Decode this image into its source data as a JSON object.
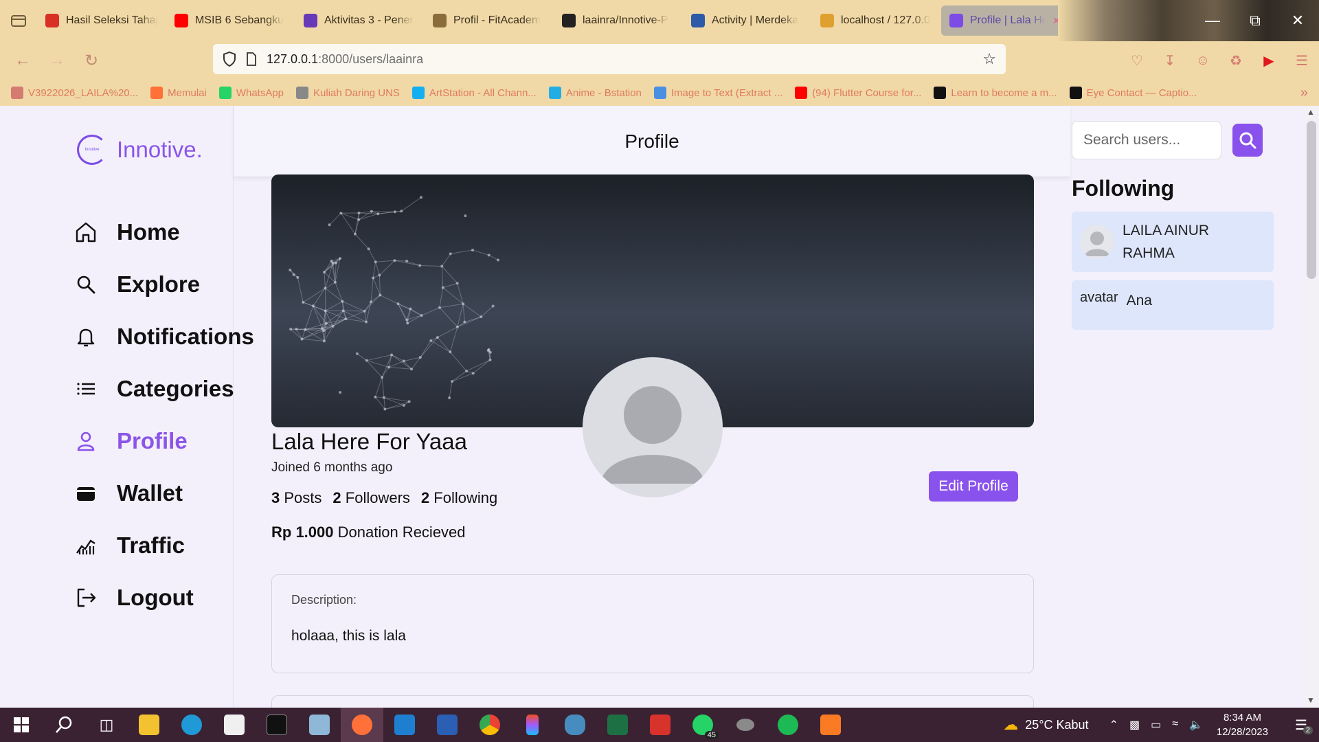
{
  "browser": {
    "tabs": [
      {
        "label": "Hasil Seleksi Tahap",
        "favicon": "gmail-icon",
        "color": "#d93025"
      },
      {
        "label": "MSIB 6 Sebangku",
        "favicon": "youtube-icon",
        "color": "#ff0000"
      },
      {
        "label": "Aktivitas 3 - Pener",
        "favicon": "forms-icon",
        "color": "#673ab7"
      },
      {
        "label": "Profil - FitAcadem",
        "favicon": "cap-icon",
        "color": "#8a6d3b"
      },
      {
        "label": "laainra/Innotive-P",
        "favicon": "github-icon",
        "color": "#222222"
      },
      {
        "label": "Activity | Merdeka",
        "favicon": "kampus-icon",
        "color": "#2d5aa8"
      },
      {
        "label": "localhost / 127.0.0",
        "favicon": "pma-icon",
        "color": "#e0a030"
      },
      {
        "label": "Profile | Lala He",
        "favicon": "loading-icon",
        "color": "#7d4be6",
        "active": true
      }
    ],
    "url": {
      "host": "127.0.0.1",
      "path": ":8000/users/laainra"
    },
    "bookmarks": [
      {
        "label": "V3922026_LAILA%20...",
        "color": "#d47b72"
      },
      {
        "label": "Memulai",
        "color": "#ff7139"
      },
      {
        "label": "WhatsApp",
        "color": "#25d366"
      },
      {
        "label": "Kuliah Daring UNS",
        "color": "#888888"
      },
      {
        "label": "ArtStation - All Chann...",
        "color": "#13aff0"
      },
      {
        "label": "Anime - Bstation",
        "color": "#23ade5"
      },
      {
        "label": "Image to Text (Extract ...",
        "color": "#4a90e2"
      },
      {
        "label": "(94) Flutter Course for...",
        "color": "#ff0000"
      },
      {
        "label": "Learn to become a m...",
        "color": "#111111"
      },
      {
        "label": "Eye Contact — Captio...",
        "color": "#111111"
      }
    ]
  },
  "app": {
    "brand": "Innotive.",
    "logo_text": "Innotive",
    "accent": "#8a52ec",
    "menu": [
      {
        "label": "Home",
        "icon": "home-icon"
      },
      {
        "label": "Explore",
        "icon": "search-icon"
      },
      {
        "label": "Notifications",
        "icon": "bell-icon"
      },
      {
        "label": "Categories",
        "icon": "list-icon"
      },
      {
        "label": "Profile",
        "icon": "user-icon",
        "active": true
      },
      {
        "label": "Wallet",
        "icon": "wallet-icon"
      },
      {
        "label": "Traffic",
        "icon": "chart-icon"
      },
      {
        "label": "Logout",
        "icon": "logout-icon"
      }
    ],
    "header_title": "Profile",
    "profile": {
      "name": "Lala Here For Yaaa",
      "joined": "Joined 6 months ago",
      "posts_count": "3",
      "posts_label": "Posts",
      "followers_count": "2",
      "followers_label": "Followers",
      "following_count": "2",
      "following_label": "Following",
      "donation_amount": "Rp 1.000",
      "donation_label": "Donation Recieved",
      "edit_label": "Edit Profile",
      "description_label": "Description:",
      "description_text": "holaaa, this is lala"
    },
    "search_placeholder": "Search users...",
    "following_title": "Following",
    "following": [
      {
        "name": "LAILA AINUR RAHMA",
        "has_avatar": true
      },
      {
        "name": "Ana",
        "avatar_alt": "avatar"
      }
    ]
  },
  "taskbar": {
    "whatsapp_badge": "45",
    "weather": "25°C  Kabut",
    "time": "8:34 AM",
    "date": "12/28/2023",
    "notification_count": "2"
  }
}
